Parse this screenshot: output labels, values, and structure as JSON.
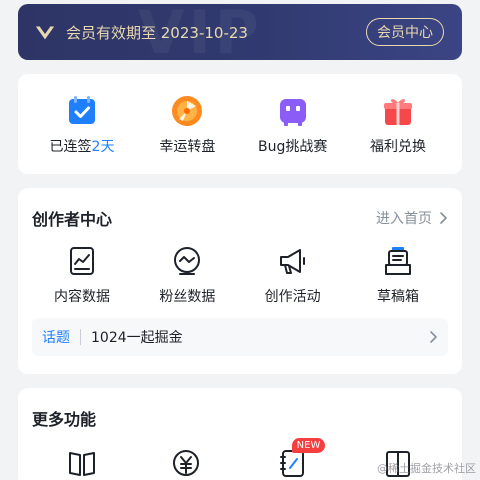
{
  "member": {
    "text": "会员有效期至 2023-10-23",
    "button_label": "会员中心",
    "watermark": "VIP",
    "text_color": "#e8d8b0"
  },
  "tasks": {
    "items": [
      {
        "label": "已连签",
        "highlight": "2天",
        "icon": "calendar-check-icon"
      },
      {
        "label": "幸运转盘",
        "icon": "lucky-wheel-icon"
      },
      {
        "label": "Bug挑战赛",
        "icon": "bug-monster-icon"
      },
      {
        "label": "福利兑换",
        "icon": "gift-icon"
      }
    ]
  },
  "creator": {
    "title": "创作者中心",
    "link_label": "进入首页",
    "items": [
      {
        "label": "内容数据",
        "icon": "content-data-icon"
      },
      {
        "label": "粉丝数据",
        "icon": "fans-data-icon"
      },
      {
        "label": "创作活动",
        "icon": "megaphone-icon"
      },
      {
        "label": "草稿箱",
        "icon": "drafts-icon"
      }
    ],
    "topic": {
      "tag": "话题",
      "text": "1024一起掘金"
    }
  },
  "more": {
    "title": "更多功能",
    "items": [
      {
        "icon": "book-icon"
      },
      {
        "icon": "yen-exchange-icon"
      },
      {
        "icon": "notebook-icon",
        "badge": "NEW"
      },
      {
        "icon": "open-book-icon"
      }
    ]
  },
  "watermark": "@稀土掘金技术社区",
  "colors": {
    "accent": "#1e80ff",
    "badge": "#f53f3f",
    "bg": "#f2f3f5"
  }
}
